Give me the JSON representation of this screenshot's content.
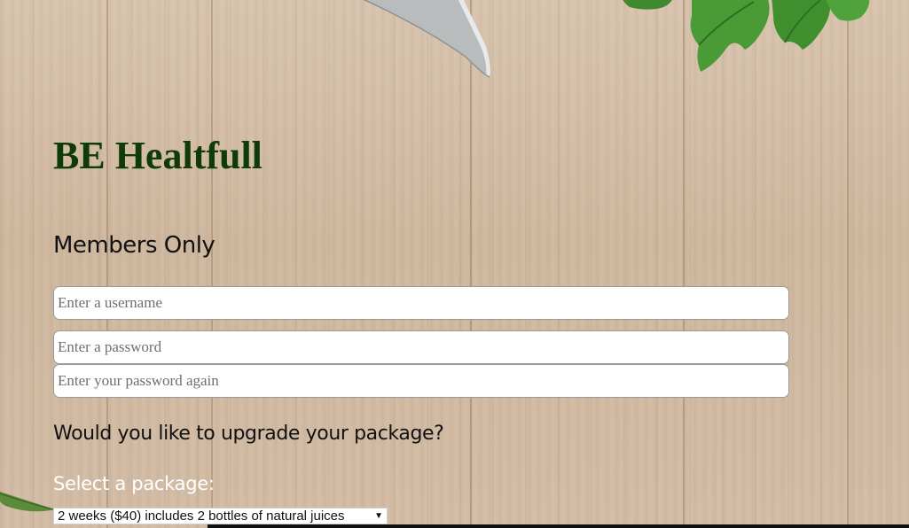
{
  "brand": {
    "title": "BE Healtfull"
  },
  "login_form": {
    "heading": "Members Only",
    "username_placeholder": "Enter a username",
    "password_placeholder": "Enter a password",
    "password_again_placeholder": "Enter your password again"
  },
  "upgrade": {
    "question": "Would you like to upgrade your package?",
    "select_label": "Select a package:",
    "selected_option": "2 weeks ($40) includes 2 bottles of natural juices"
  },
  "icons": {
    "knife": "knife-blade-icon",
    "parsley": "parsley-leaves-icon",
    "leaf": "leaf-icon",
    "select_arrow": "chevron-down-icon"
  },
  "colors": {
    "brand_title": "#0f3a0a",
    "background_wood": "#d2bca6",
    "select_label": "#ffffff"
  }
}
